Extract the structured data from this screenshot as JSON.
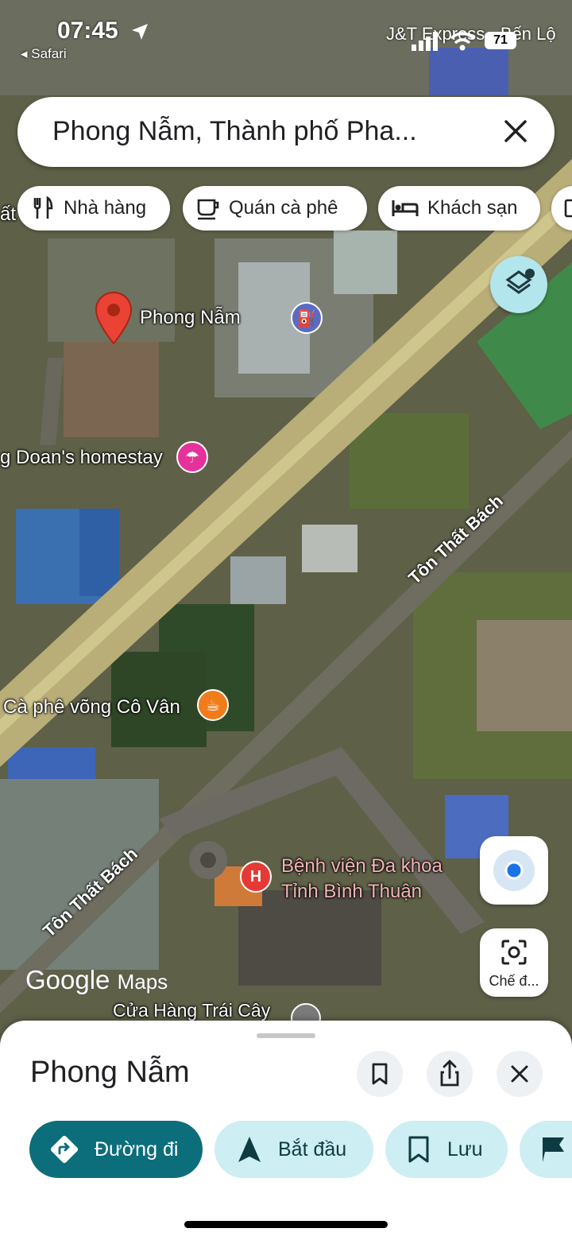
{
  "status_bar": {
    "time": "07:45",
    "back_app": "◂ Safari",
    "carrier_overlay": "J&T Express - Bến Lộ",
    "battery": "71"
  },
  "search": {
    "query": "Phong Nẫm, Thành phố Pha..."
  },
  "chips": [
    {
      "label": "Nhà hàng",
      "icon": "restaurant-icon"
    },
    {
      "label": "Quán cà phê",
      "icon": "coffee-icon"
    },
    {
      "label": "Khách sạn",
      "icon": "hotel-icon"
    }
  ],
  "map": {
    "pin_label": "Phong Nẫm",
    "places": {
      "homestay": "g Doan's homestay",
      "cafe": "Cà phê võng Cô Vân",
      "hospital_line1": "Bệnh viện Đa khoa",
      "hospital_line2": "Tỉnh Bình Thuận",
      "fruit_store": "Cửa Hàng Trái Cây",
      "edge_left": "ất"
    },
    "roads": {
      "road_upper": "Tôn Thất Bách",
      "road_lower": "Tôn Thất Bách"
    },
    "attribution_brand": "Google",
    "attribution_product": "Maps",
    "lens_label": "Chế đ..."
  },
  "sheet": {
    "title": "Phong Nẫm",
    "actions": [
      {
        "label": "Đường đi",
        "icon": "directions-icon"
      },
      {
        "label": "Bắt đầu",
        "icon": "navigation-arrow-icon"
      },
      {
        "label": "Lưu",
        "icon": "bookmark-icon"
      }
    ]
  },
  "colors": {
    "accent_teal": "#0b6e7a",
    "light_teal": "#cdeef2",
    "pin_red": "#ea4335",
    "poi_pink": "#e5329a",
    "poi_orange": "#f07c1c",
    "poi_blue": "#5c6bc0",
    "hospital_red": "#e53935"
  }
}
